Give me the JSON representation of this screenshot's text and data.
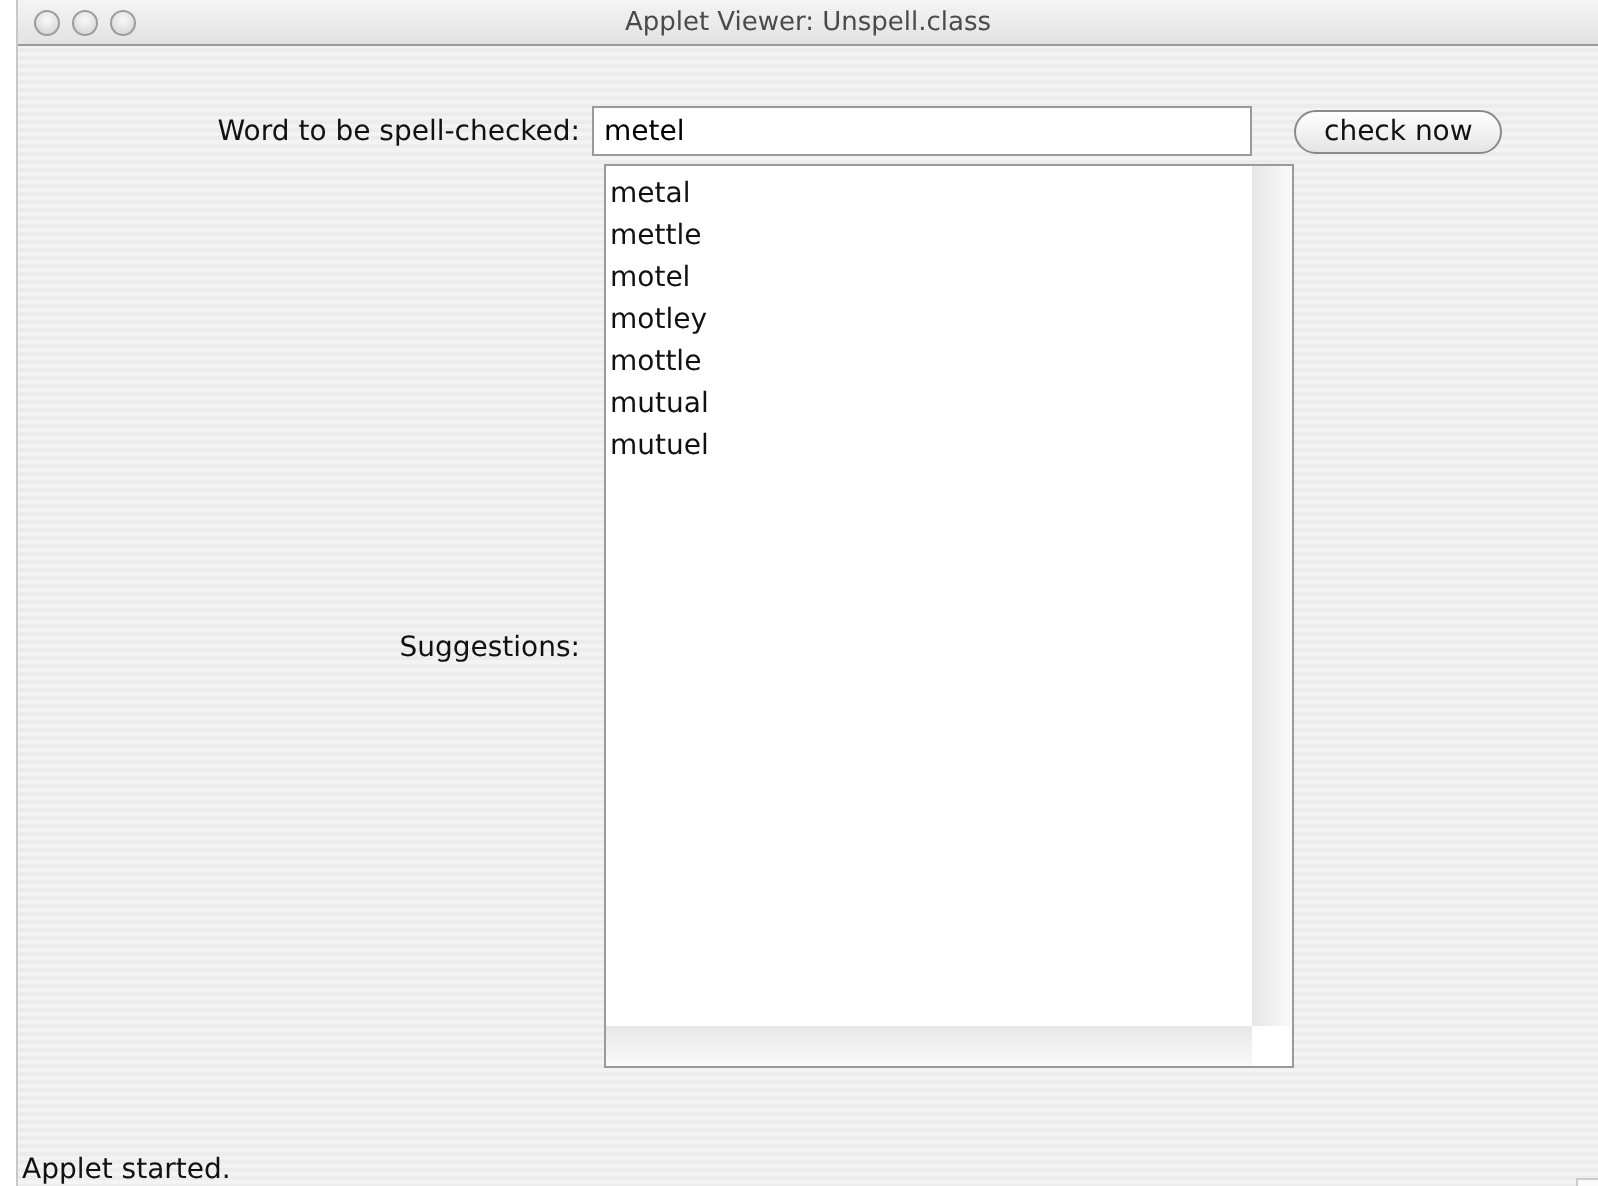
{
  "window": {
    "title": "Applet Viewer: Unspell.class"
  },
  "word_field": {
    "label": "Word to be spell-checked:",
    "value": "metel"
  },
  "check_button": {
    "label": "check now"
  },
  "suggestions": {
    "label": "Suggestions:",
    "items": [
      "metal",
      "mettle",
      "motel",
      "motley",
      "mottle",
      "mutual",
      "mutuel"
    ]
  },
  "status_bar": {
    "text": "Applet started."
  }
}
